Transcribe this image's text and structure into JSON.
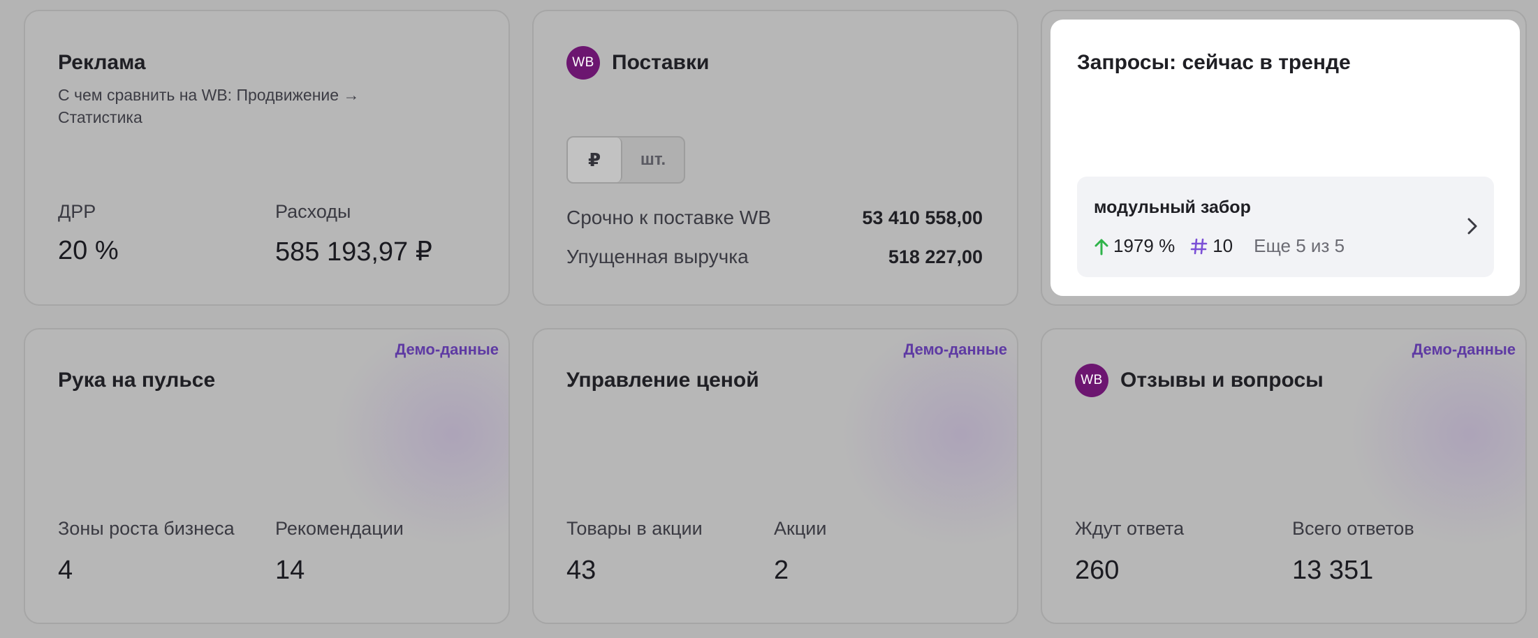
{
  "ads": {
    "title": "Реклама",
    "subtitle": "С чем сравнить на WB: Продвижение → Статистика",
    "metric1_label": "ДРР",
    "metric1_value": "20 %",
    "metric2_label": "Расходы",
    "metric2_value": "585 193,97 ₽"
  },
  "supplies": {
    "logo_text": "WB",
    "title": "Поставки",
    "toggle_rub": "₽",
    "toggle_pcs": "шт.",
    "rows": [
      {
        "label": "Срочно к поставке WB",
        "value": "53 410 558,00"
      },
      {
        "label": "Упущенная выручка",
        "value": "518 227,00"
      }
    ]
  },
  "trends": {
    "title": "Запросы: сейчас в тренде",
    "query": "модульный забор",
    "growth": "1979 %",
    "rank": "10",
    "more": "Еще 5 из 5"
  },
  "pulse": {
    "badge": "Демо-данные",
    "title": "Рука на пульсе",
    "metric1_label": "Зоны роста бизнеса",
    "metric1_value": "4",
    "metric2_label": "Рекомендации",
    "metric2_value": "14"
  },
  "price": {
    "badge": "Демо-данные",
    "title": "Управление ценой",
    "metric1_label": "Товары в акции",
    "metric1_value": "43",
    "metric2_label": "Акции",
    "metric2_value": "2"
  },
  "reviews": {
    "badge": "Демо-данные",
    "logo_text": "WB",
    "title": "Отзывы и вопросы",
    "metric1_label": "Ждут ответа",
    "metric1_value": "260",
    "metric2_label": "Всего ответов",
    "metric2_value": "13 351"
  },
  "colors": {
    "wb_brand": "#6c1670",
    "demo_badge": "#5e3aa3",
    "growth_arrow": "#2fb34a",
    "rank_hash": "#7b4fd6"
  }
}
